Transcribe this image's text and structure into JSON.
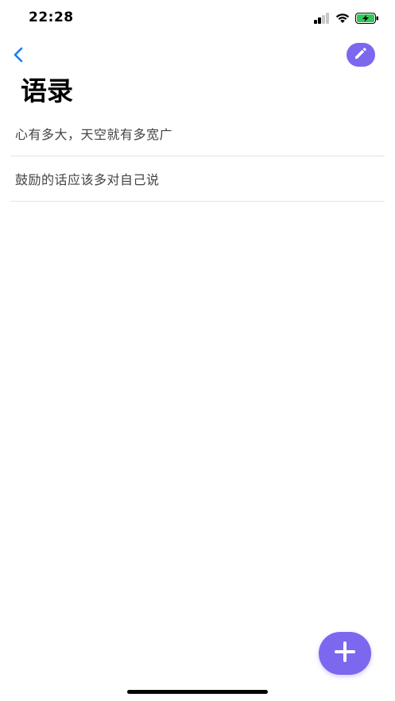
{
  "status_bar": {
    "time": "22:28",
    "icons": [
      "signal-icon",
      "wifi-icon",
      "battery-charging-icon"
    ]
  },
  "header": {
    "back_icon": "chevron-left-icon",
    "edit_icon": "pencil-icon",
    "title": "语录"
  },
  "quotes": [
    {
      "text": "心有多大，天空就有多宽广"
    },
    {
      "text": "鼓励的话应该多对自己说"
    }
  ],
  "fab": {
    "icon": "plus-icon"
  },
  "colors": {
    "accent": "#7b68ee",
    "link_blue": "#1a7cf5",
    "battery_green": "#34c759",
    "divider": "#e3e3e3"
  }
}
